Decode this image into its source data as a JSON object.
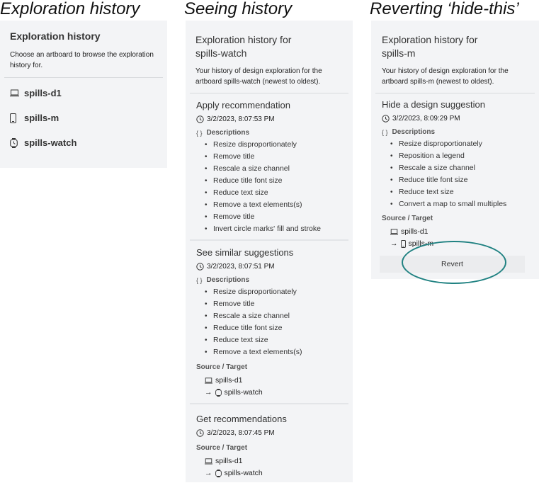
{
  "captions": {
    "left": "Exploration history",
    "middle": "Seeing history",
    "right": "Reverting ‘hide-this’"
  },
  "panel1": {
    "title": "Exploration history",
    "intro": "Choose an artboard to browse the exploration history for.",
    "artboards": [
      {
        "icon": "laptop-icon",
        "label": "spills-d1"
      },
      {
        "icon": "phone-icon",
        "label": "spills-m"
      },
      {
        "icon": "watch-icon",
        "label": "spills-watch"
      }
    ]
  },
  "panel2": {
    "title_line1": "Exploration history for",
    "title_line2": "spills-watch",
    "intro": "Your history of design exploration for the artboard spills-watch (newest to oldest).",
    "entries": [
      {
        "title": "Apply recommendation",
        "timestamp": "3/2/2023, 8:07:53 PM",
        "desc_label": "Descriptions",
        "descriptions": [
          "Resize disproportionately",
          "Remove title",
          "Rescale a size channel",
          "Reduce title font size",
          "Reduce text size",
          "Remove a text elements(s)",
          "Remove title",
          "Invert circle marks' fill and stroke"
        ]
      },
      {
        "title": "See similar suggestions",
        "timestamp": "3/2/2023, 8:07:51 PM",
        "desc_label": "Descriptions",
        "descriptions": [
          "Resize disproportionately",
          "Remove title",
          "Rescale a size channel",
          "Reduce title font size",
          "Reduce text size",
          "Remove a text elements(s)"
        ],
        "st_label": "Source / Target",
        "source": "spills-d1",
        "target": "spills-watch"
      },
      {
        "title": "Get recommendations",
        "timestamp": "3/2/2023, 8:07:45 PM",
        "st_label": "Source / Target",
        "source": "spills-d1",
        "target": "spills-watch"
      }
    ]
  },
  "panel3": {
    "title_line1": "Exploration history for",
    "title_line2": "spills-m",
    "intro": "Your history of design exploration for the artboard spills-m (newest to oldest).",
    "entry": {
      "title": "Hide a design suggestion",
      "timestamp": "3/2/2023, 8:09:29 PM",
      "desc_label": "Descriptions",
      "descriptions": [
        "Resize disproportionately",
        "Reposition a legend",
        "Rescale a size channel",
        "Reduce title font size",
        "Reduce text size",
        "Convert a map to small multiples"
      ],
      "st_label": "Source / Target",
      "source": "spills-d1",
      "target": "spills-m"
    },
    "revert_label": "Revert",
    "highlight_color": "#1f8181"
  },
  "glyphs": {
    "arrow": "→",
    "brace": "{ }"
  }
}
